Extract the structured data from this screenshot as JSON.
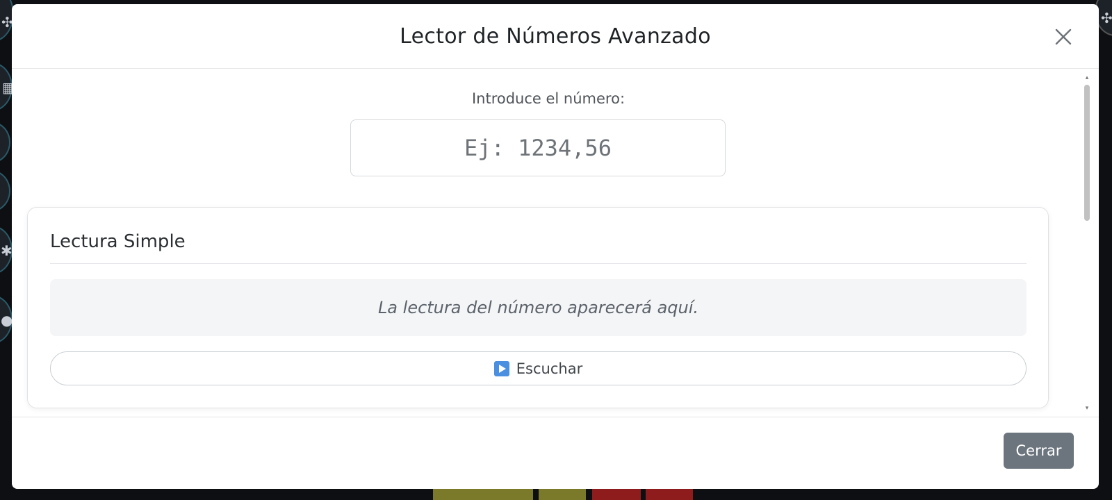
{
  "modal": {
    "title": "Lector de Números Avanzado"
  },
  "number_input": {
    "label": "Introduce el número:",
    "placeholder": "Ej: 1234,56",
    "value": ""
  },
  "simple_reading_card": {
    "title": "Lectura Simple",
    "reading_placeholder": "La lectura del número aparecerá aquí.",
    "listen_button_label": "Escuchar",
    "listen_icon": "play-icon"
  },
  "footer": {
    "close_button_label": "Cerrar"
  },
  "colors": {
    "close_button_bg": "#6c757d",
    "play_icon": "#4a8fe0",
    "reading_box_bg": "#f4f5f7",
    "backdrop": "#0e0f12"
  },
  "icons": {
    "close": "close-icon",
    "background_app": [
      "share-icon",
      "calculator-icon",
      "settings-icon",
      "help-icon"
    ]
  }
}
